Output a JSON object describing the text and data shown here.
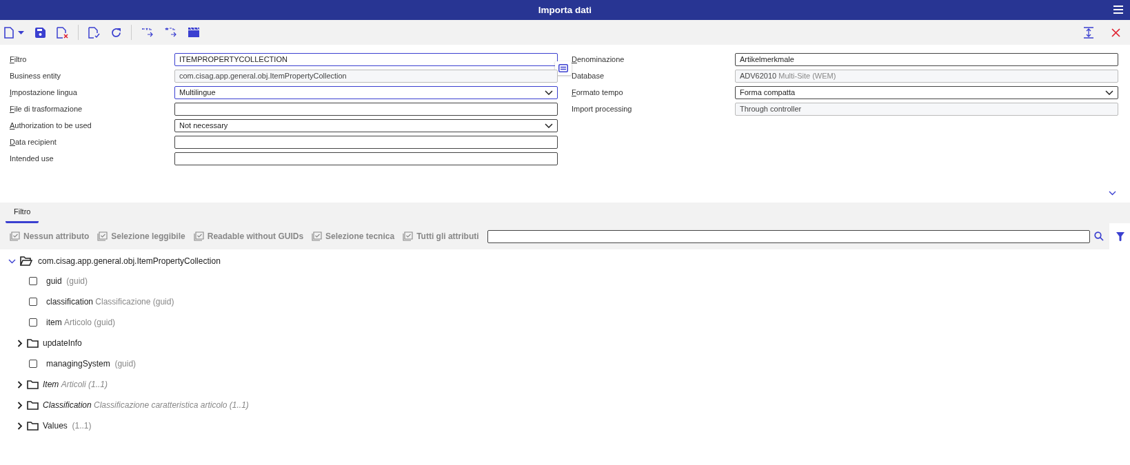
{
  "window": {
    "title": "Importa dati"
  },
  "form": {
    "left": [
      {
        "label": "Filtro",
        "mnemonic": true,
        "kind": "text",
        "value": "ITEMPROPERTYCOLLECTION",
        "active": true
      },
      {
        "label": "Business entity",
        "mnemonic": false,
        "kind": "readonly",
        "value": "com.cisag.app.general.obj.ItemPropertyCollection"
      },
      {
        "label": "Impostazione lingua",
        "mnemonic": true,
        "kind": "select",
        "value": "Multilingue",
        "active": true
      },
      {
        "label": "File di trasformazione",
        "mnemonic": true,
        "kind": "text",
        "active": false
      },
      {
        "label": "Authorization to be used",
        "mnemonic": true,
        "kind": "select",
        "value": "Not necessary",
        "active": false
      },
      {
        "label": "Data recipient",
        "mnemonic": true,
        "kind": "text",
        "active": false
      },
      {
        "label": "Intended use",
        "mnemonic": false,
        "kind": "text",
        "active": false
      }
    ],
    "right": [
      {
        "label": "Denominazione",
        "mnemonic": true,
        "kind": "text",
        "value": "Artikelmerkmale",
        "active": false
      },
      {
        "label": "Database",
        "mnemonic": false,
        "kind": "readonly",
        "value": "ADV62010",
        "note": "Multi-Site (WEM)"
      },
      {
        "label": "Formato tempo",
        "mnemonic": true,
        "kind": "select",
        "value": "Forma compatta",
        "active": false
      },
      {
        "label": "Import processing",
        "mnemonic": false,
        "kind": "readonly",
        "value": "Through controller"
      }
    ]
  },
  "tabs": [
    {
      "label": "Filtro",
      "selected": true
    }
  ],
  "filter_buttons": [
    "Nessun attributo",
    "Selezione leggibile",
    "Readable without GUIDs",
    "Selezione tecnica",
    "Tutti gli attributi"
  ],
  "tree": {
    "root": {
      "name": "com.cisag.app.general.obj.ItemPropertyCollection",
      "expanded": true
    },
    "children": [
      {
        "kind": "attribute",
        "name": "guid",
        "suffix": "(guid)",
        "checked": false,
        "italic": false
      },
      {
        "kind": "attribute",
        "name": "classification",
        "description": "Classificazione",
        "suffix": "(guid)",
        "checked": false,
        "italic": false
      },
      {
        "kind": "attribute",
        "name": "item",
        "description": "Articolo",
        "suffix": "(guid)",
        "checked": false,
        "italic": false
      },
      {
        "kind": "folder",
        "name": "updateInfo",
        "expanded": false,
        "italic": false
      },
      {
        "kind": "attribute",
        "name": "managingSystem",
        "suffix": "(guid)",
        "checked": false,
        "italic": false
      },
      {
        "kind": "folder",
        "name": "Item",
        "description": "Articoli",
        "suffix": "(1..1)",
        "expanded": false,
        "italic": true
      },
      {
        "kind": "folder",
        "name": "Classification",
        "description": "Classificazione caratteristica articolo",
        "suffix": "(1..1)",
        "expanded": false,
        "italic": true
      },
      {
        "kind": "folder",
        "name": "Values",
        "suffix": "(1..1)",
        "expanded": false,
        "italic": false
      }
    ]
  }
}
